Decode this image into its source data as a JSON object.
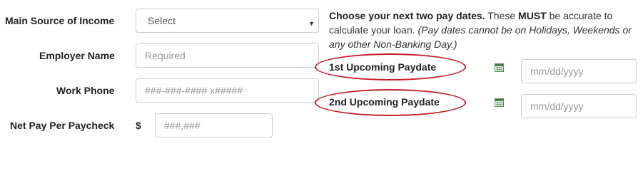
{
  "form": {
    "income_label": "Main Source of Income",
    "income_select": "Select",
    "employer_label": "Employer Name",
    "employer_placeholder": "Required",
    "phone_label": "Work Phone",
    "phone_placeholder": "###-###-#### x#####",
    "netpay_label": "Net Pay Per Paycheck",
    "currency_symbol": "$",
    "netpay_placeholder": "###,###"
  },
  "paydates": {
    "intro_bold": "Choose your next two pay dates.",
    "intro_text1": " These ",
    "intro_must": "MUST",
    "intro_text2": " be accurate to calculate your loan. ",
    "intro_italic": "(Pay dates cannot be on Holidays, Weekends or any other Non-Banking Day.)",
    "first_label": "1st Upcoming Paydate",
    "second_label": "2nd Upcoming Paydate",
    "date_placeholder": "mm/dd/yyyy",
    "highlight_color": "#c41e2a"
  }
}
